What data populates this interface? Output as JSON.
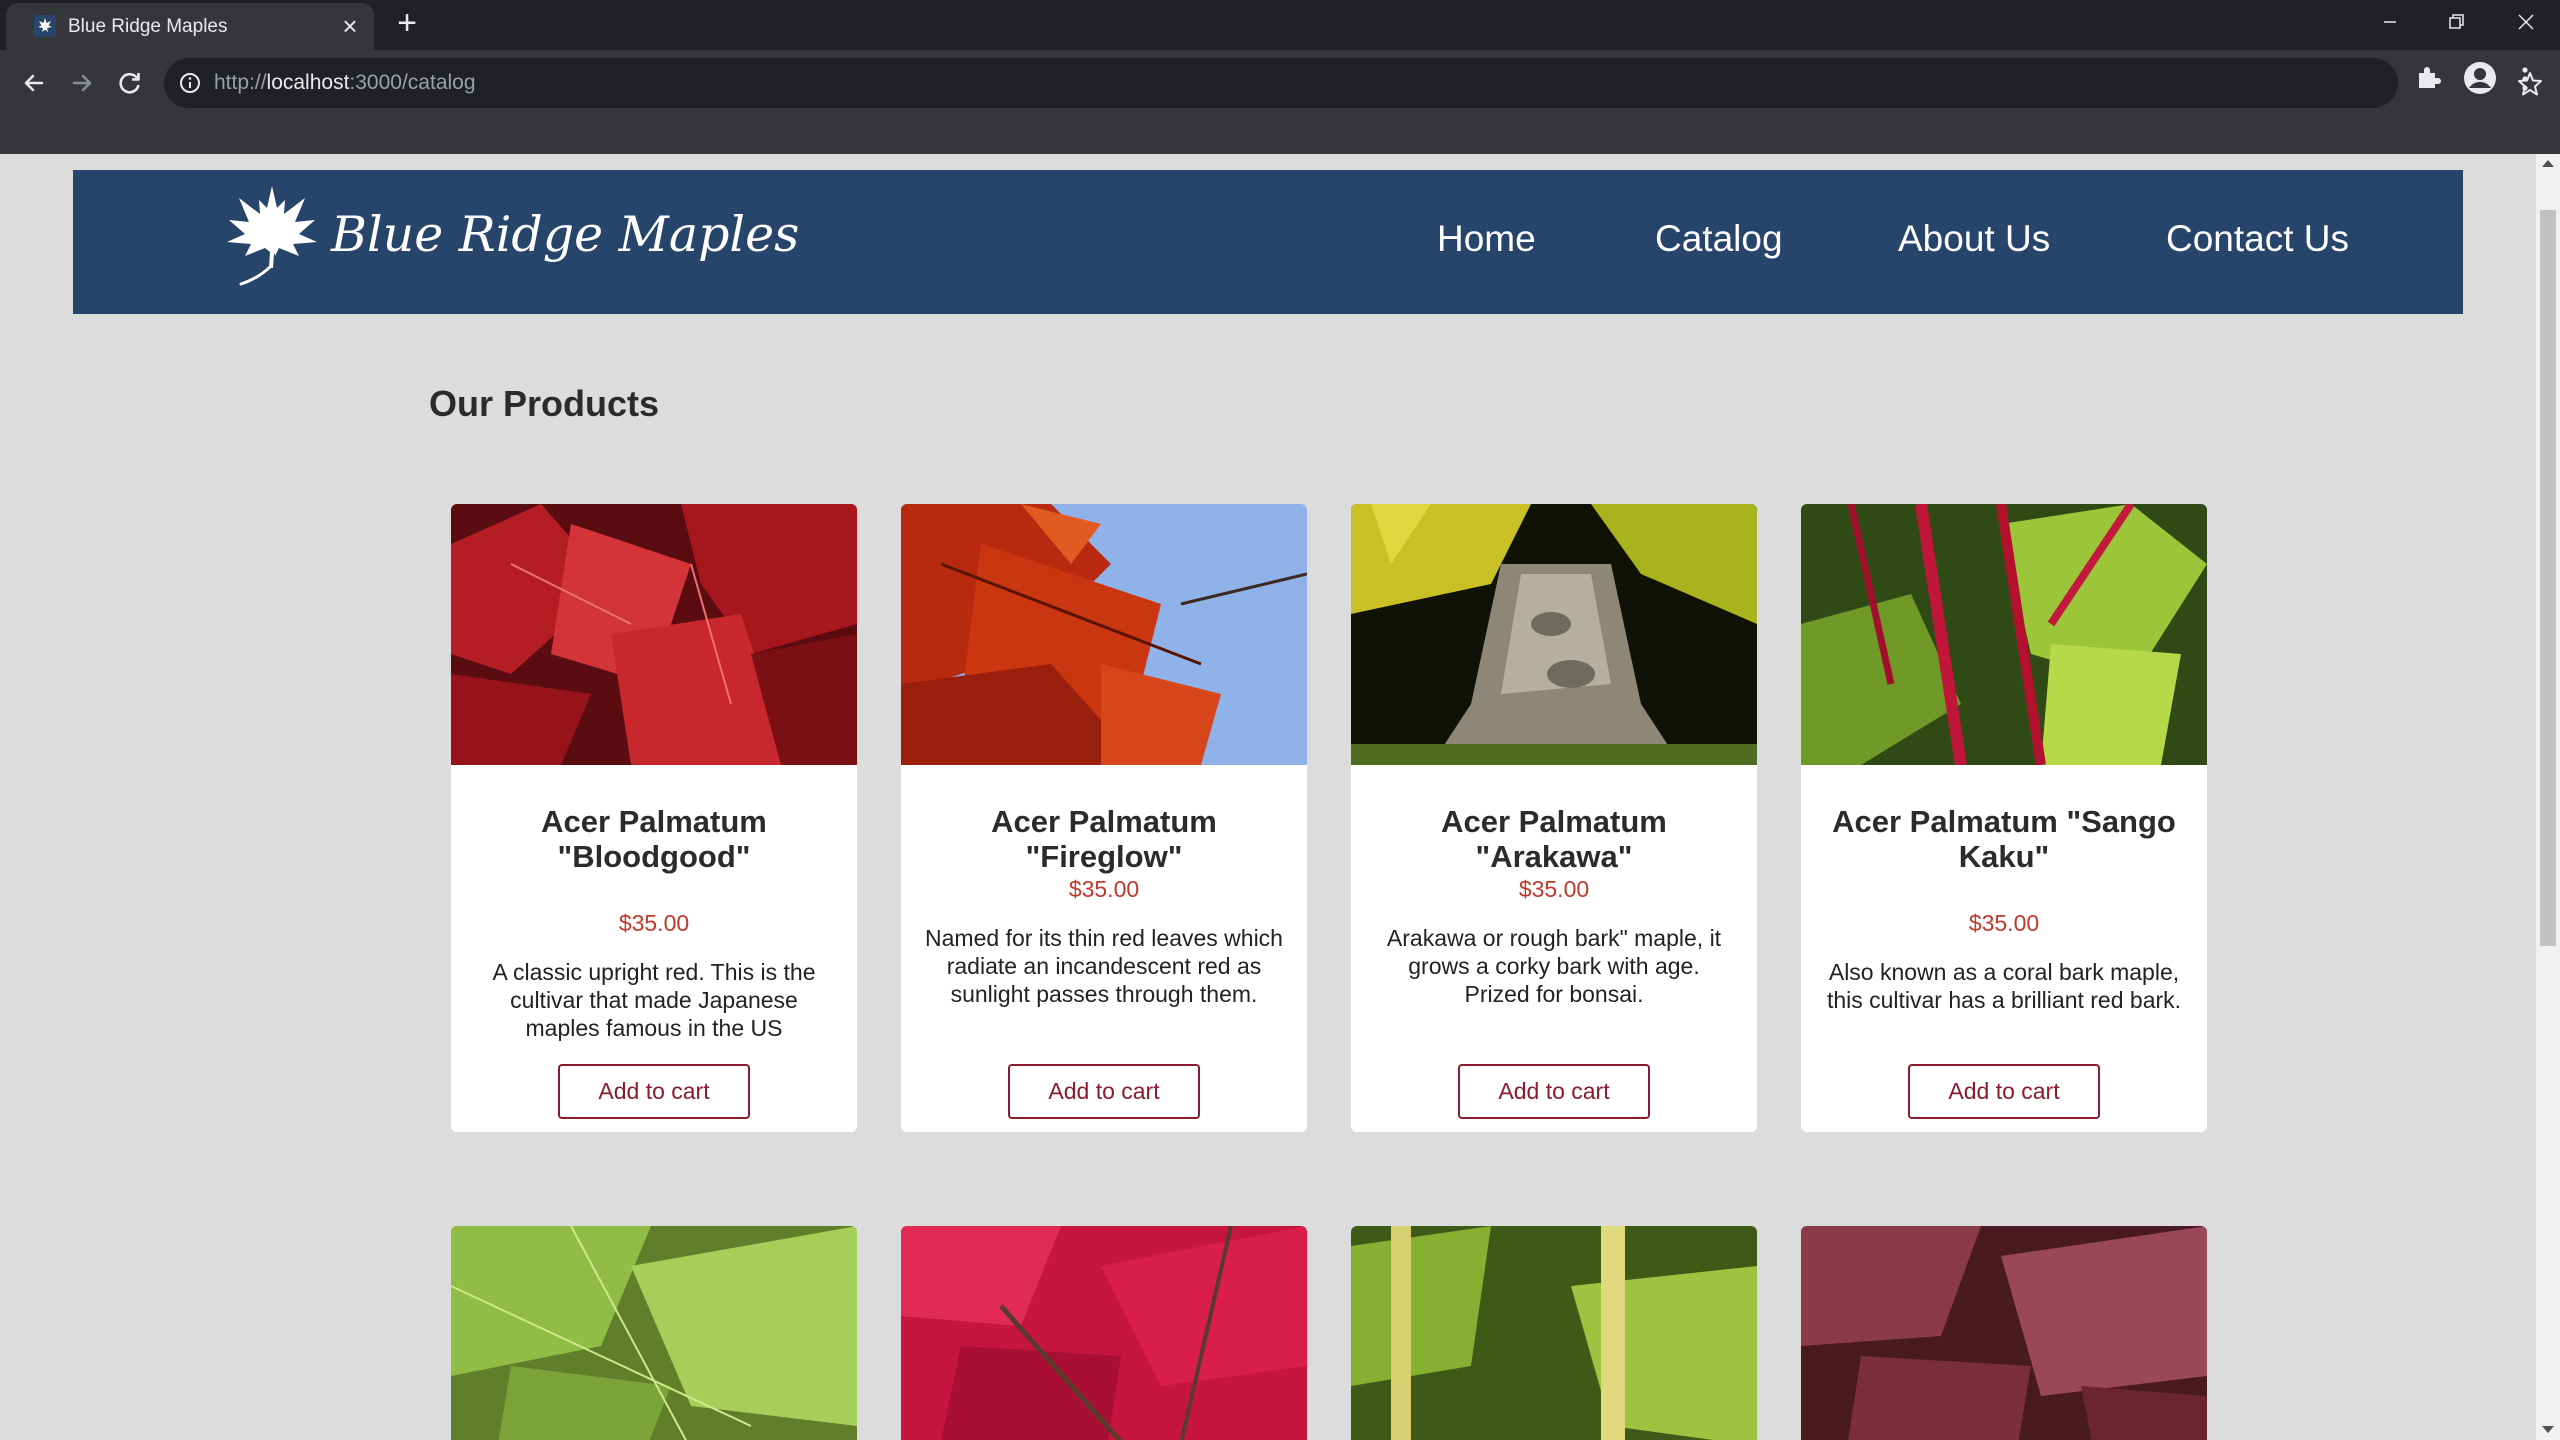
{
  "browser": {
    "tab_title": "Blue Ridge Maples",
    "url_scheme": "http://",
    "url_host": "localhost",
    "url_rest": ":3000/catalog",
    "theme": "#202124"
  },
  "site": {
    "logo_text": "Blue Ridge Maples",
    "nav": [
      "Home",
      "Catalog",
      "About Us",
      "Contact Us"
    ],
    "header_color": "#27456b"
  },
  "main": {
    "title": "Our Products",
    "products": [
      {
        "name": "Acer Palmatum \"Bloodgood\"",
        "price": "$35.00",
        "description": "A classic upright red. This is the cultivar that made Japanese maples famous in the US",
        "button": "Add to cart",
        "image": "red-maple-leaves"
      },
      {
        "name": "Acer Palmatum \"Fireglow\"",
        "price": "$35.00",
        "description": "Named for its thin red leaves which radiate an incandescent red as sunlight passes through them.",
        "button": "Add to cart",
        "image": "red-leaves-blue-sky"
      },
      {
        "name": "Acer Palmatum \"Arakawa\"",
        "price": "$35.00",
        "description": "Arakawa or rough bark\" maple, it grows a corky bark with age. Prized for bonsai.",
        "button": "Add to cart",
        "image": "bonsai-trunk"
      },
      {
        "name": "Acer Palmatum \"Sango Kaku\"",
        "price": "$35.00",
        "description": "Also known as a coral bark maple, this cultivar has a brilliant red bark.",
        "button": "Add to cart",
        "image": "coral-bark-green-leaves"
      }
    ],
    "more_products": [
      "lace-leaf-green",
      "bright-red-canopy",
      "yellow-bark-green",
      "purple-leaves"
    ]
  }
}
